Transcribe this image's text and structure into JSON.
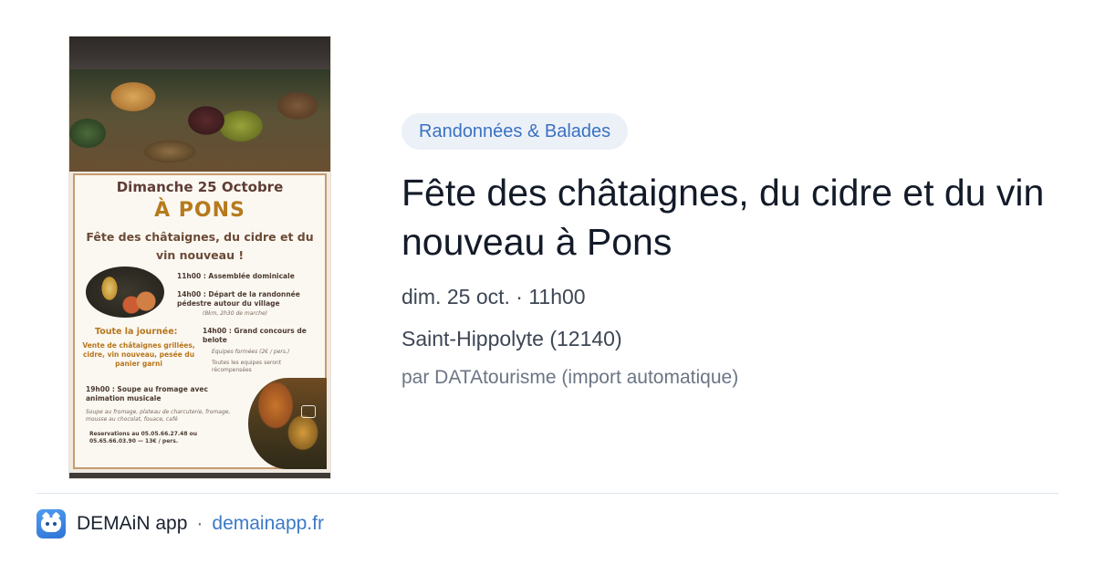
{
  "poster": {
    "date": "Dimanche 25 Octobre",
    "town": "À PONS",
    "title": "Fête des châtaignes, du cidre et du vin nouveau !",
    "schedule": {
      "t1": "11h00 : Assemblée dominicale",
      "t2": "14h00 : Départ de la randonnée pédestre autour du village",
      "t2_note": "(8km, 2h30 de marche)",
      "allday_title": "Toute la journée:",
      "allday_text": "Vente de châtaignes grillées, cidre, vin nouveau, pesée du panier garni",
      "t3": "14h00 : Grand concours de belote",
      "t3_note1": "Equipes formées (2€ / pers.)",
      "t3_note2": "Toutes les equipes seront récompensées",
      "t4": "19h00 : Soupe au fromage avec animation musicale",
      "t4_note": "Soupe au fromage, plateau de charcuterie, fromage, mousse au chocolat, fouace, café",
      "reservation": "Reservations au 05.05.66.27.48 ou 05.65.66.03.90 — 13€ / pers."
    }
  },
  "event": {
    "category": "Randonnées & Balades",
    "title": "Fête des châtaignes, du cidre et du vin nouveau à Pons",
    "datetime": "dim. 25 oct. · 11h00",
    "location": "Saint-Hippolyte (12140)",
    "author": "par DATAtourisme (import automatique)"
  },
  "footer": {
    "brand": "DEMAiN app",
    "separator": "·",
    "domain": "demainapp.fr"
  },
  "colors": {
    "category_bg": "#ecf1f8",
    "category_text": "#3a71c2",
    "title_text": "#131a28",
    "link": "#3c79c8"
  },
  "icons": {
    "app_logo": "demain-app-logo-icon",
    "fullscreen": "fullscreen-icon"
  }
}
